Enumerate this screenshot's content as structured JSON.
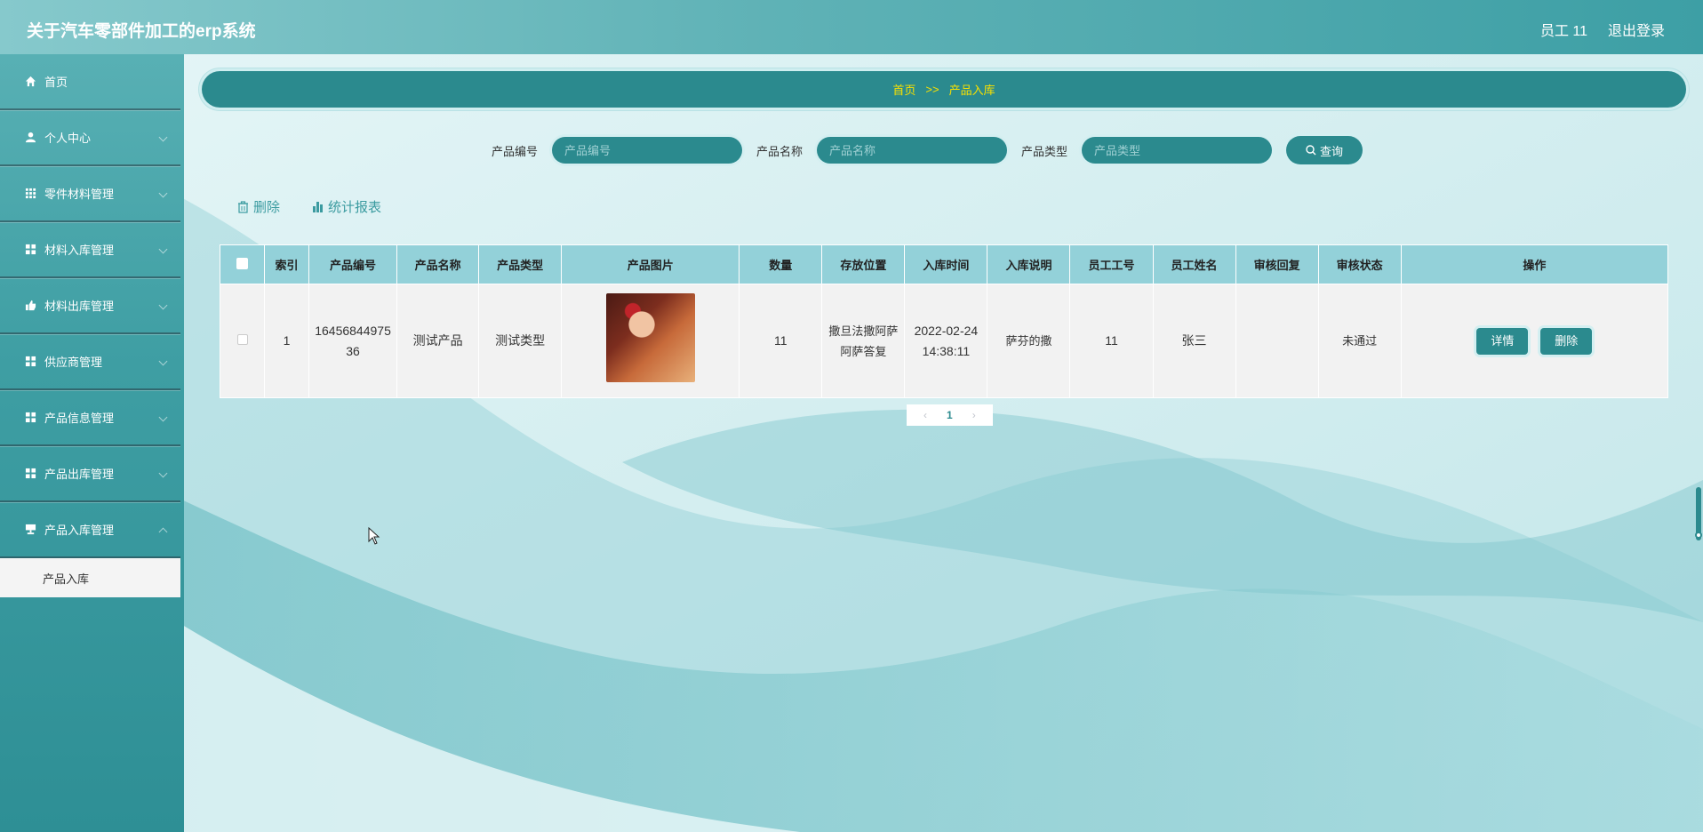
{
  "header": {
    "title": "关于汽车零部件加工的erp系统",
    "user": "员工 11",
    "logout": "退出登录"
  },
  "sidebar": {
    "items": [
      {
        "label": "首页",
        "icon": "home-icon"
      },
      {
        "label": "个人中心",
        "icon": "user-icon"
      },
      {
        "label": "零件材料管理",
        "icon": "grid-icon"
      },
      {
        "label": "材料入库管理",
        "icon": "grid-icon"
      },
      {
        "label": "材料出库管理",
        "icon": "thumb-icon"
      },
      {
        "label": "供应商管理",
        "icon": "grid-icon"
      },
      {
        "label": "产品信息管理",
        "icon": "grid-icon"
      },
      {
        "label": "产品出库管理",
        "icon": "grid-icon"
      },
      {
        "label": "产品入库管理",
        "icon": "monitor-icon"
      }
    ],
    "active_sub": "产品入库"
  },
  "breadcrumb": {
    "home": "首页",
    "sep": ">>",
    "current": "产品入库"
  },
  "search": {
    "fields": [
      {
        "label": "产品编号",
        "placeholder": "产品编号"
      },
      {
        "label": "产品名称",
        "placeholder": "产品名称"
      },
      {
        "label": "产品类型",
        "placeholder": "产品类型"
      }
    ],
    "button": "查询"
  },
  "actions": {
    "delete": "删除",
    "report": "统计报表"
  },
  "table": {
    "headers": [
      "索引",
      "产品编号",
      "产品名称",
      "产品类型",
      "产品图片",
      "数量",
      "存放位置",
      "入库时间",
      "入库说明",
      "员工工号",
      "员工姓名",
      "审核回复",
      "审核状态",
      "操作"
    ],
    "rows": [
      {
        "index": "1",
        "code": "1645684497536",
        "name": "测试产品",
        "type": "测试类型",
        "qty": "11",
        "location": "撒旦法撒阿萨阿萨答复",
        "time": "2022-02-24 14:38:11",
        "note": "萨芬的撒",
        "emp_no": "11",
        "emp_name": "张三",
        "reply": "",
        "status": "未通过",
        "detail_btn": "详情",
        "delete_btn": "删除"
      }
    ]
  },
  "pagination": {
    "current": "1"
  },
  "colors": {
    "accent": "#2b8a8e",
    "breadcrumb_text": "#f8e000",
    "table_header": "#93d1d9"
  }
}
